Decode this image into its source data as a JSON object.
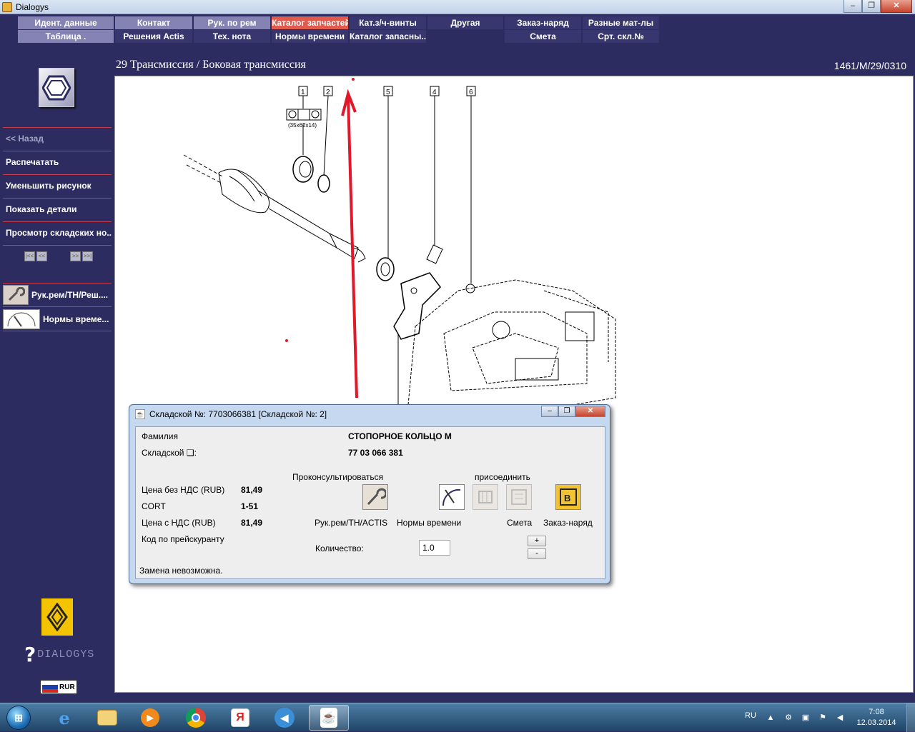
{
  "window": {
    "title": "Dialogys"
  },
  "menu": {
    "row1": [
      {
        "label": "Идент. данные"
      },
      {
        "label": "Контакт"
      },
      {
        "label": "Рук. по рем"
      },
      {
        "label": "Каталог запчастей"
      },
      {
        "label": "Кат.з/ч-винты"
      },
      {
        "label": "Другая"
      },
      {
        "label": "Заказ-наряд"
      },
      {
        "label": "Разные мат-лы"
      }
    ],
    "row2": [
      {
        "label": "Таблица ."
      },
      {
        "label": "Решения Actis"
      },
      {
        "label": "Тех. нота"
      },
      {
        "label": "Нормы времени"
      },
      {
        "label": "Каталог запасны..."
      },
      {
        "label": "Смета"
      },
      {
        "label": "Срт. скл.№"
      }
    ]
  },
  "sidebar": {
    "back": "<< Назад",
    "links": [
      {
        "label": "Распечатать"
      },
      {
        "label": "Уменьшить рисунок"
      },
      {
        "label": "Показать детали"
      },
      {
        "label": "Просмотр складских но..."
      }
    ],
    "pager": [
      "|<<",
      "<<",
      ">>",
      ">>|"
    ],
    "tools": [
      {
        "label": "Рук.рем/ТН/Реш...."
      },
      {
        "label": "Нормы време..."
      }
    ],
    "logo_text": "DIALOGYS",
    "currency": "RUR"
  },
  "content": {
    "breadcrumb": "29 Трансмиссия / Боковая трансмиссия",
    "reference": "1461/M/29/0310",
    "callouts": [
      "1",
      "2",
      "5",
      "4",
      "6"
    ],
    "part_dimension": "(35x62x14)"
  },
  "dialog": {
    "title": "Складской №: 7703066381 [Складской №: 2]",
    "family_label": "Фамилия",
    "family_value": "СТОПОРНОЕ КОЛЬЦО М",
    "stock_label": "Складской ❑:",
    "stock_value": "77 03 066 381",
    "consult_label": "Проконсультироваться",
    "attach_label": "присоединить",
    "price_ex_label": "Цена без НДС (RUB)",
    "price_ex_value": "81,49",
    "cort_label": "CORT",
    "cort_value": "1-51",
    "price_inc_label": "Цена с НДС (RUB)",
    "price_inc_value": "81,49",
    "pricelist_label": "Код по прейскуранту",
    "btn_labels": {
      "manual": "Рук.рем/ТН/ACTIS",
      "labour": "Нормы времени",
      "estimate": "Смета",
      "order": "Заказ-наряд"
    },
    "qty_label": "Количество:",
    "qty_value": "1.0",
    "spin_plus": "+",
    "spin_minus": "-",
    "status": "Замена невозможна."
  },
  "taskbar": {
    "lang": "RU",
    "time": "7:08",
    "date": "12.03.2014"
  },
  "colors": {
    "background": "#2c2c61",
    "menu_light": "#8583b4",
    "menu_active": "#e15a4e",
    "divider": "#c43c4a",
    "annotation_arrow": "#e0182a"
  }
}
